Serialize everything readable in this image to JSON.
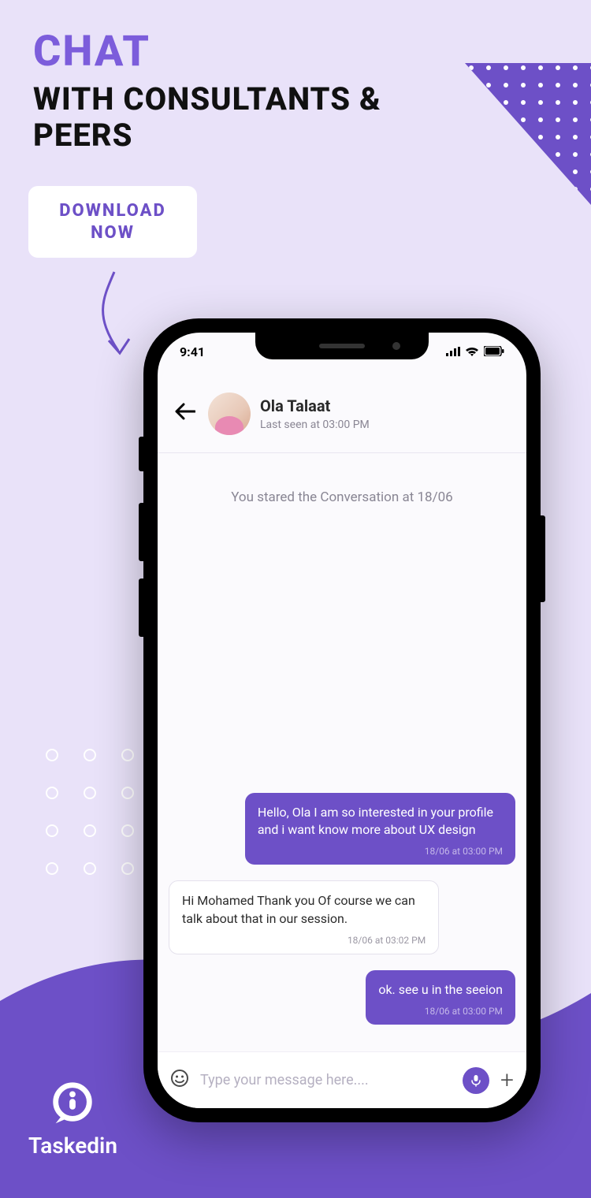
{
  "heading": {
    "line1": "CHAT",
    "line2": "WITH CONSULTANTS & PEERS"
  },
  "cta": {
    "label": "DOWNLOAD NOW"
  },
  "brand": {
    "name": "Taskedin"
  },
  "phone": {
    "status_time": "9:41",
    "header": {
      "name": "Ola Talaat",
      "last_seen": "Last seen at 03:00 PM"
    },
    "conversation_start": "You stared the Conversation at 18/06",
    "messages": [
      {
        "type": "sent",
        "text": "Hello, Ola I am so interested in your profile and i want know more about UX design",
        "timestamp": "18/06 at 03:00 PM"
      },
      {
        "type": "received",
        "text": "Hi Mohamed Thank you Of course we can talk about that in our session.",
        "timestamp": "18/06 at 03:02 PM"
      },
      {
        "type": "sent",
        "text": "ok. see u in the seeion",
        "timestamp": "18/06 at 03:00 PM"
      }
    ],
    "composer": {
      "placeholder": "Type your message here...."
    }
  }
}
